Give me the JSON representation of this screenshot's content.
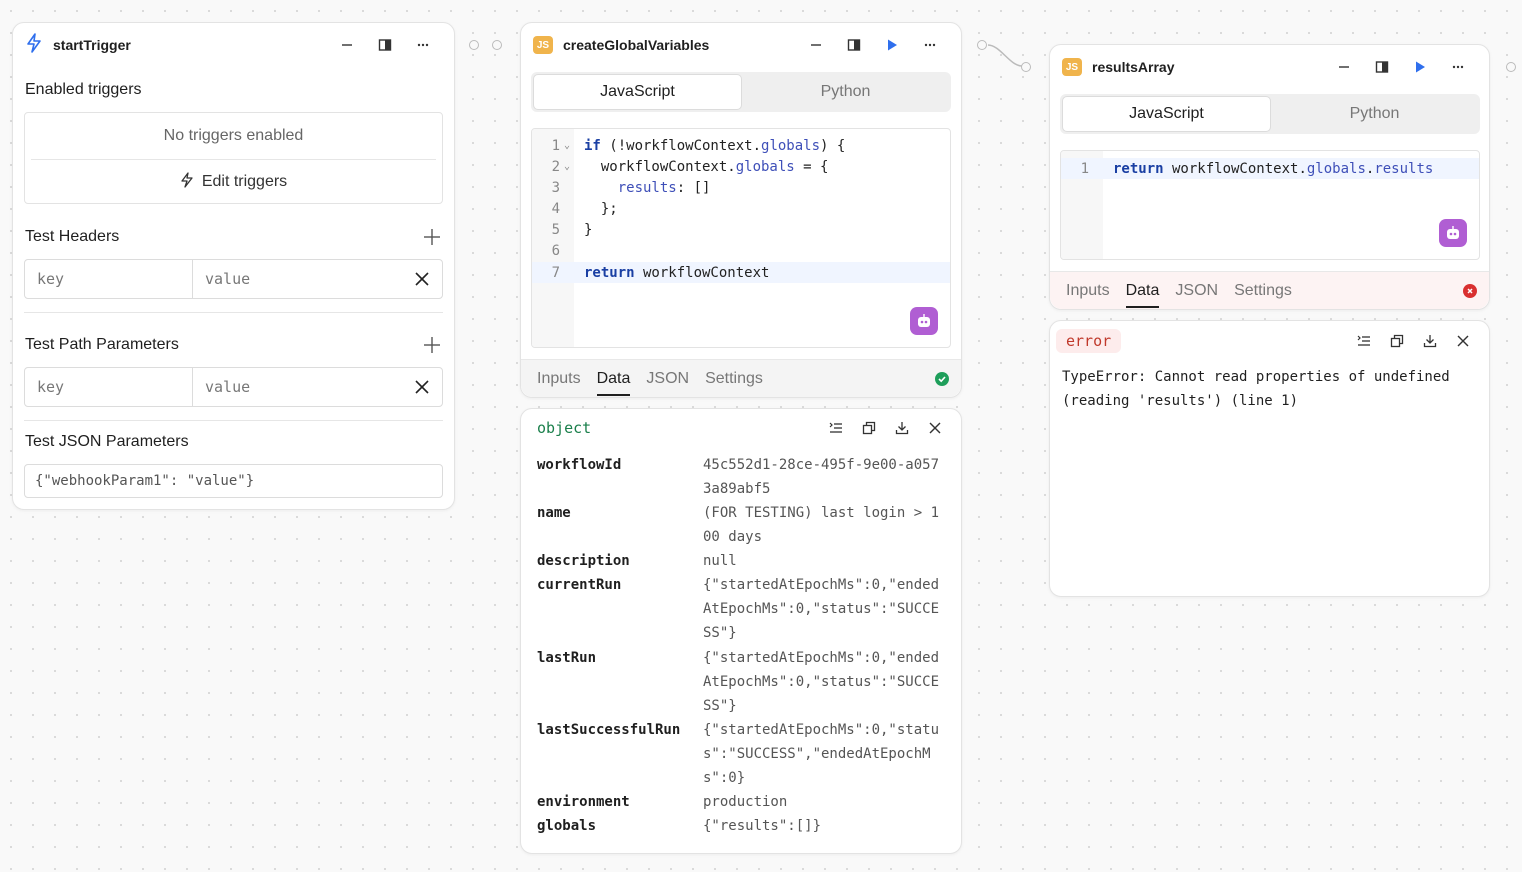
{
  "trigger_card": {
    "title": "startTrigger",
    "enabled_label": "Enabled triggers",
    "no_triggers": "No triggers enabled",
    "edit_triggers": "Edit triggers",
    "headers_label": "Test Headers",
    "path_label": "Test Path Parameters",
    "json_label": "Test JSON Parameters",
    "key_placeholder": "key",
    "value_placeholder": "value",
    "json_value": "{\"webhookParam1\": \"value\"}"
  },
  "global_card": {
    "badge": "JS",
    "title": "createGlobalVariables",
    "tabs": [
      "JavaScript",
      "Python"
    ],
    "active_tab": "JavaScript",
    "line_numbers": [
      "1",
      "2",
      "3",
      "4",
      "5",
      "6",
      "7"
    ],
    "code_lines": [
      "if (!workflowContext.globals) {",
      "  workflowContext.globals = {",
      "    results: []",
      "  };",
      "}",
      "",
      "return workflowContext"
    ],
    "bottom_tabs": [
      "Inputs",
      "Data",
      "JSON",
      "Settings"
    ],
    "active_bottom_tab": "Data",
    "status": "success"
  },
  "global_output": {
    "type": "object",
    "rows": [
      {
        "key": "workflowId",
        "value": "45c552d1-28ce-495f-9e00-a0573a89abf5"
      },
      {
        "key": "name",
        "value": "(FOR TESTING) last login > 100 days"
      },
      {
        "key": "description",
        "value": "null"
      },
      {
        "key": "currentRun",
        "value": "{\"startedAtEpochMs\":0,\"endedAtEpochMs\":0,\"status\":\"SUCCESS\"}"
      },
      {
        "key": "lastRun",
        "value": "{\"startedAtEpochMs\":0,\"endedAtEpochMs\":0,\"status\":\"SUCCESS\"}"
      },
      {
        "key": "lastSuccessfulRun",
        "value": "{\"startedAtEpochMs\":0,\"status\":\"SUCCESS\",\"endedAtEpochMs\":0}"
      },
      {
        "key": "environment",
        "value": "production"
      },
      {
        "key": "globals",
        "value": "{\"results\":[]}"
      }
    ]
  },
  "results_card": {
    "badge": "JS",
    "title": "resultsArray",
    "tabs": [
      "JavaScript",
      "Python"
    ],
    "active_tab": "JavaScript",
    "line_numbers": [
      "1"
    ],
    "code_lines": [
      "return workflowContext.globals.results"
    ],
    "bottom_tabs": [
      "Inputs",
      "Data",
      "JSON",
      "Settings"
    ],
    "active_bottom_tab": "Data",
    "status": "error"
  },
  "results_output": {
    "type": "error",
    "message": "TypeError: Cannot read properties of undefined (reading 'results') (line 1)"
  },
  "colors": {
    "run": "#2f6fed",
    "success": "#1e9e5a",
    "error": "#d93030",
    "ai": "#b05ed3",
    "js_badge": "#f0b44c"
  }
}
